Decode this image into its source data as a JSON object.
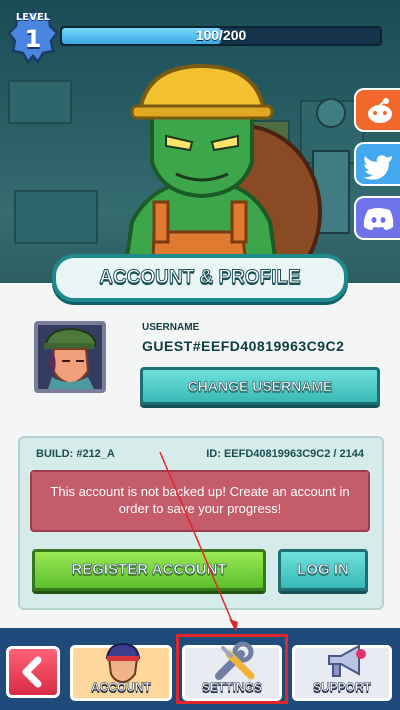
{
  "header": {
    "level_label": "LEVEL",
    "level_value": "1",
    "xp_text": "100/200",
    "xp_progress": 0.5
  },
  "social": {
    "reddit": "reddit-icon",
    "twitter": "twitter-icon",
    "discord": "discord-icon"
  },
  "panel": {
    "title": "ACCOUNT & PROFILE",
    "username_label": "USERNAME",
    "username_value": "GUEST#EEFD40819963C9C2",
    "change_username_button": "CHANGE USERNAME",
    "build": "BUILD: #212_A",
    "account_id": "ID: EEFD40819963C9C2 / 2144",
    "warning": "This account is not backed up! Create an account in order to save your progress!",
    "register_button": "REGISTER ACCOUNT",
    "login_button": "LOG IN"
  },
  "nav": {
    "back_icon": "chevron-left-icon",
    "account_label": "ACCOUNT",
    "settings_label": "SETTINGS",
    "support_label": "SUPPORT"
  },
  "colors": {
    "accent_teal": "#38b9b6",
    "register_green": "#5cc02c",
    "warning_red": "#c55c6a",
    "highlight_red": "#e0262b",
    "nav_blue": "#1f4a7a"
  }
}
